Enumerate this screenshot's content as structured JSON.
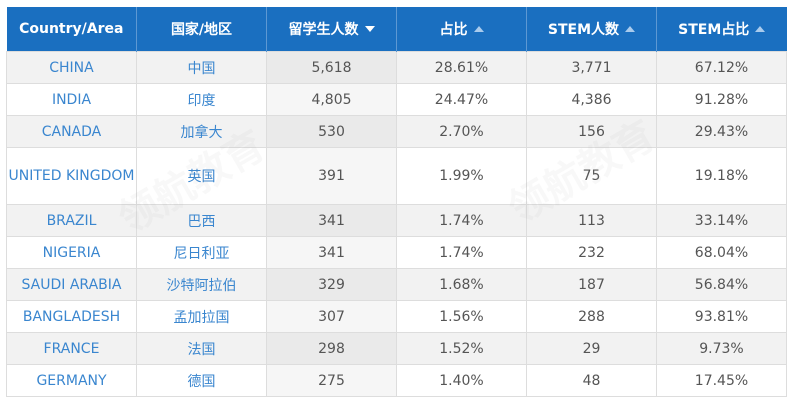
{
  "header": {
    "col_country": "Country/Area",
    "col_cn": "国家/地区",
    "col_students": "留学生人数",
    "col_share": "占比",
    "col_stem": "STEM人数",
    "col_stem_share": "STEM占比"
  },
  "rows": [
    {
      "country": "CHINA",
      "cn": "中国",
      "students": "5,618",
      "share": "28.61%",
      "stem": "3,771",
      "stem_share": "67.12%"
    },
    {
      "country": "INDIA",
      "cn": "印度",
      "students": "4,805",
      "share": "24.47%",
      "stem": "4,386",
      "stem_share": "91.28%"
    },
    {
      "country": "CANADA",
      "cn": "加拿大",
      "students": "530",
      "share": "2.70%",
      "stem": "156",
      "stem_share": "29.43%"
    },
    {
      "country": "UNITED KINGDOM",
      "cn": "英国",
      "students": "391",
      "share": "1.99%",
      "stem": "75",
      "stem_share": "19.18%"
    },
    {
      "country": "BRAZIL",
      "cn": "巴西",
      "students": "341",
      "share": "1.74%",
      "stem": "113",
      "stem_share": "33.14%"
    },
    {
      "country": "NIGERIA",
      "cn": "尼日利亚",
      "students": "341",
      "share": "1.74%",
      "stem": "232",
      "stem_share": "68.04%"
    },
    {
      "country": "SAUDI ARABIA",
      "cn": "沙特阿拉伯",
      "students": "329",
      "share": "1.68%",
      "stem": "187",
      "stem_share": "56.84%"
    },
    {
      "country": "BANGLADESH",
      "cn": "孟加拉国",
      "students": "307",
      "share": "1.56%",
      "stem": "288",
      "stem_share": "93.81%"
    },
    {
      "country": "FRANCE",
      "cn": "法国",
      "students": "298",
      "share": "1.52%",
      "stem": "29",
      "stem_share": "9.73%"
    },
    {
      "country": "GERMANY",
      "cn": "德国",
      "students": "275",
      "share": "1.40%",
      "stem": "48",
      "stem_share": "17.45%"
    }
  ],
  "watermark": {
    "text": "领航教育"
  },
  "colors": {
    "header_bg": "#1a6fc0",
    "link": "#3a86cf",
    "row_alt": "#f2f2f2"
  }
}
